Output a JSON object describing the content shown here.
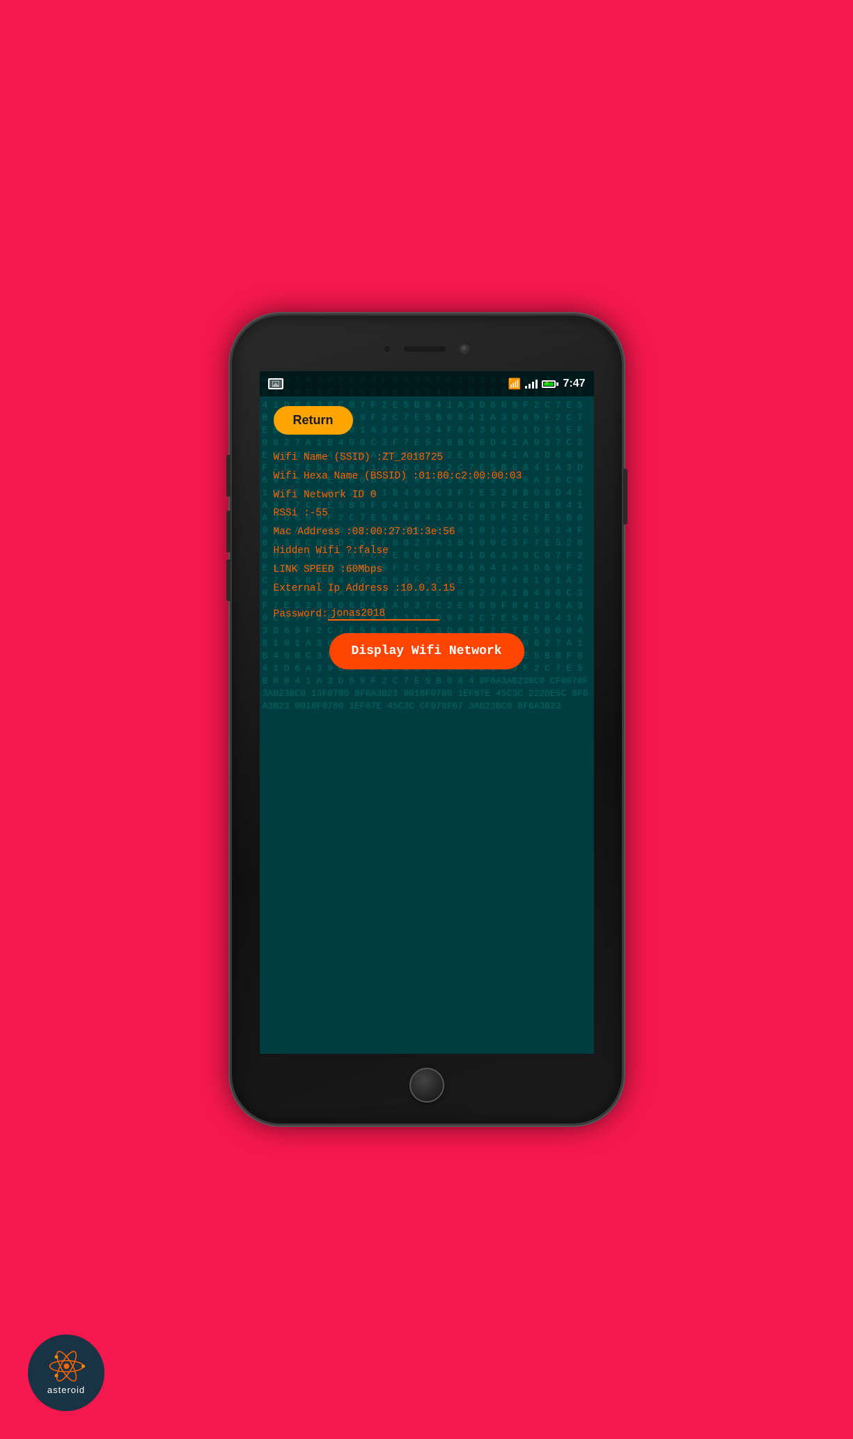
{
  "background_color": "#f5184e",
  "status_bar": {
    "time": "7:47",
    "wifi": "▲",
    "signal": "▲",
    "battery": "▲"
  },
  "buttons": {
    "return_label": "Return",
    "display_wifi_label": "Display Wifi Network"
  },
  "wifi_info": {
    "ssid_label": "Wifi Name (SSID) :",
    "ssid_value": "ZT_2018725",
    "bssid_label": "Wifi Hexa Name (BSSID) :",
    "bssid_value": "01:80:c2:00:00:03",
    "network_id_label": "Wifi Network ID ",
    "network_id_value": "0",
    "rssi_label": "RSSi :",
    "rssi_value": "-55",
    "mac_label": "Mac Address :",
    "mac_value": "08:00:27:01:3e:56",
    "hidden_label": "Hidden Wifi ?:",
    "hidden_value": "false",
    "link_speed_label": "LINK SPEED :",
    "link_speed_value": "60Mbps",
    "ext_ip_label": "External Ip Address :",
    "ext_ip_value": "10.0.3.15",
    "password_label": "Password:",
    "password_value": "jonas2018"
  },
  "matrix_chars": "8 1 0 1 A 3 0 5 8 2 4 F 6 A 3 8 C 0 1 D 3 5 E F 0 8 2 7 A 1 B 4 9 0 C 3 F 7 E 5 2 8 B 0 6 D 4 1 A 9 3 7 C 2 E 5 B 0 F 8 4 1 D 6 A 3 9 C 0 7 F 2 E 5 B 8 4 1 A 3 D 6 0 9 F 2 C 7 E 5 B 0 8 4 1 A 3 D 6 9 F 2 C 7 E 5 B 0 8 4 1 A 3 D 6 9 F 2 C 7 E 5 B 0 8 4",
  "asteroid": {
    "label": "asteroid"
  }
}
